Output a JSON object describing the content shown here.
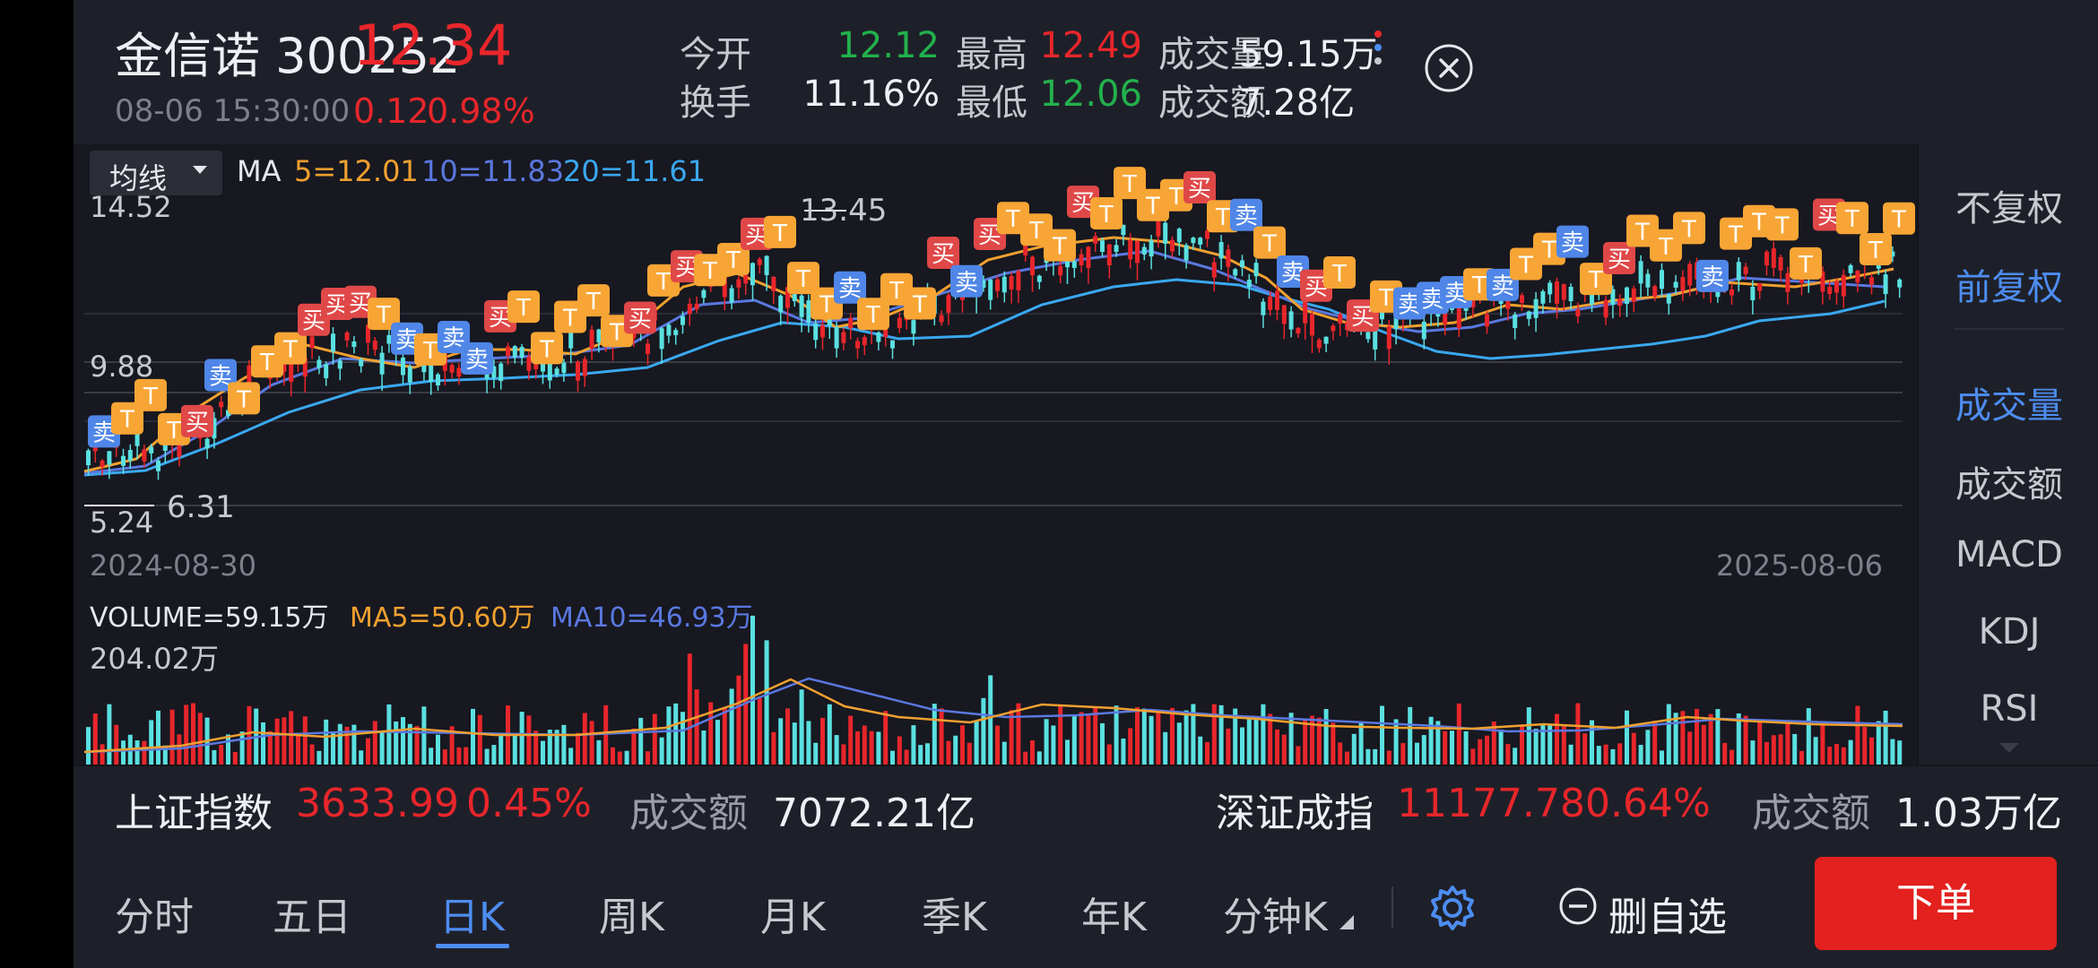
{
  "stock": {
    "name_code": "金信诺 300252",
    "price": "12.34",
    "time": "08-06 15:30:00",
    "change": "0.12",
    "change_pct": "0.98%"
  },
  "stats": {
    "open_label": "今开",
    "open": "12.12",
    "high_label": "最高",
    "high": "12.49",
    "volume_label": "成交量",
    "volume": "59.15万",
    "turnover_label": "换手",
    "turnover": "11.16%",
    "low_label": "最低",
    "low": "12.06",
    "amount_label": "成交额",
    "amount": "7.28亿"
  },
  "chart": {
    "indicator_select": "均线",
    "ma_label": "MA",
    "ma5": "5=12.01",
    "ma10": "10=11.83",
    "ma20": "20=11.61",
    "y_top": "14.52",
    "y_mid": "9.88",
    "y_low": "5.24",
    "max_label": "13.45",
    "min_label": "6.31",
    "date_start": "2024-08-30",
    "date_end": "2025-08-06",
    "volume_label": "VOLUME=59.15万",
    "vol_ma5": "MA5=50.60万",
    "vol_ma10": "MA10=46.93万",
    "vol_max": "204.02万",
    "marker_t": "T",
    "marker_buy": "买",
    "marker_sell": "卖"
  },
  "side_menu": {
    "items": [
      "不复权",
      "前复权",
      "成交量",
      "成交额",
      "MACD",
      "KDJ",
      "RSI"
    ]
  },
  "index_strip": {
    "sh_name": "上证指数",
    "sh_value": "3633.99",
    "sh_pct": "0.45%",
    "sh_amt_label": "成交额",
    "sh_amt": "7072.21亿",
    "sz_name": "深证成指",
    "sz_value": "11177.78",
    "sz_pct": "0.64%",
    "sz_amt_label": "成交额",
    "sz_amt": "1.03万亿"
  },
  "tabs": [
    "分时",
    "五日",
    "日K",
    "周K",
    "月K",
    "季K",
    "年K",
    "分钟K"
  ],
  "actions": {
    "remove_watch": "删自选",
    "order": "下单"
  },
  "colors": {
    "up": "#e8262b",
    "down": "#5ae0e0",
    "green": "#22b14c",
    "accent": "#4d8df0",
    "ma5": "#f0a030",
    "ma10": "#5a78e0",
    "ma20": "#3aa8f0",
    "marker_t": "#f7a535"
  }
}
